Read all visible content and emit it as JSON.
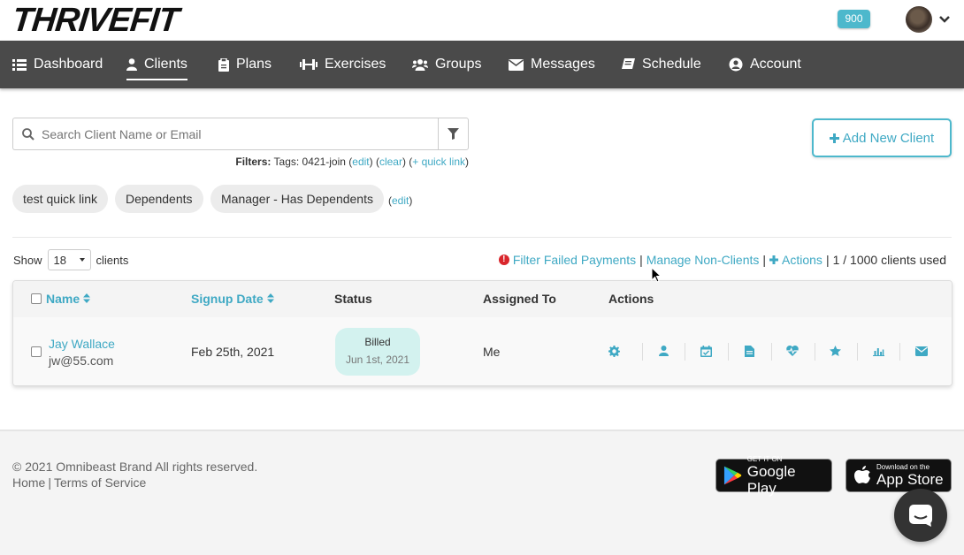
{
  "brand": {
    "logo_thrive": "THRIVE",
    "logo_fit": "FIT"
  },
  "header": {
    "notification_count": "900"
  },
  "nav": {
    "items": [
      {
        "label": "Dashboard",
        "icon": "list-icon"
      },
      {
        "label": "Clients",
        "icon": "user-icon",
        "active": true
      },
      {
        "label": "Plans",
        "icon": "clipboard-icon"
      },
      {
        "label": "Exercises",
        "icon": "dumbbell-icon"
      },
      {
        "label": "Groups",
        "icon": "users-icon"
      },
      {
        "label": "Messages",
        "icon": "envelope-icon"
      },
      {
        "label": "Schedule",
        "icon": "book-icon"
      },
      {
        "label": "Account",
        "icon": "user-circle-icon"
      }
    ]
  },
  "search": {
    "placeholder": "Search Client Name or Email"
  },
  "filters": {
    "label": "Filters:",
    "text": "Tags: 0421-join",
    "edit": "edit",
    "clear": "clear",
    "quick_link": "+ quick link"
  },
  "add_client": {
    "label": "Add New Client"
  },
  "quick_links": {
    "chips": [
      "test quick link",
      "Dependents",
      "Manager - Has Dependents"
    ],
    "edit": "edit"
  },
  "show": {
    "prefix": "Show",
    "value": "18",
    "suffix": "clients"
  },
  "table_actions": {
    "failed_payments": "Filter Failed Payments",
    "manage_non_clients": "Manage Non-Clients",
    "actions": "Actions",
    "usage": "1 / 1000 clients used"
  },
  "table": {
    "headers": {
      "name": "Name",
      "signup": "Signup Date",
      "status": "Status",
      "assigned": "Assigned To",
      "actions": "Actions"
    },
    "rows": [
      {
        "name": "Jay Wallace",
        "email": "jw@55.com",
        "signup": "Feb 25th, 2021",
        "status": "Billed",
        "status_date": "Jun 1st, 2021",
        "assigned": "Me",
        "action_icons": [
          "gear-icon",
          "user-icon",
          "calendar-check-icon",
          "file-icon",
          "heartbeat-icon",
          "star-icon",
          "bar-chart-icon",
          "envelope-icon"
        ]
      }
    ]
  },
  "footer": {
    "copyright": "© 2021 Omnibeast Brand All rights reserved.",
    "home": "Home",
    "terms": "Terms of Service",
    "google_small": "GET IT ON",
    "google_big": "Google Play",
    "apple_small": "Download on the",
    "apple_big": "App Store"
  },
  "colors": {
    "accent": "#4db8cc",
    "nav_bg": "#4a4a4a",
    "status_bg": "#d3f2ef"
  }
}
